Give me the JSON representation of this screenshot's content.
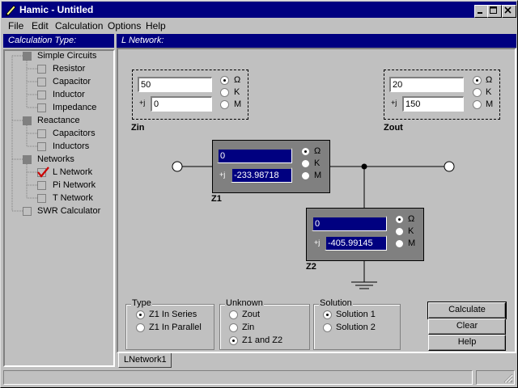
{
  "window": {
    "title": "Hamic - Untitled"
  },
  "menu": [
    "File",
    "Edit",
    "Calculation",
    "Options",
    "Help"
  ],
  "sidebar": {
    "header": "Calculation Type:",
    "items": [
      {
        "label": "Simple Circuits",
        "level": 0
      },
      {
        "label": "Resistor",
        "level": 1
      },
      {
        "label": "Capacitor",
        "level": 1
      },
      {
        "label": "Inductor",
        "level": 1
      },
      {
        "label": "Impedance",
        "level": 1
      },
      {
        "label": "Reactance",
        "level": 0
      },
      {
        "label": "Capacitors",
        "level": 1
      },
      {
        "label": "Inductors",
        "level": 1
      },
      {
        "label": "Networks",
        "level": 0
      },
      {
        "label": "L Network",
        "level": 1,
        "checked": true
      },
      {
        "label": "Pi Network",
        "level": 1
      },
      {
        "label": "T Network",
        "level": 1
      },
      {
        "label": "SWR Calculator",
        "level": 0
      }
    ]
  },
  "main": {
    "header": "L Network:",
    "units": [
      "Ω",
      "K",
      "M"
    ],
    "j_prefix": "+j",
    "zin": {
      "label": "Zin",
      "real": "50",
      "imag": "0",
      "unit": "Ω"
    },
    "zout": {
      "label": "Zout",
      "real": "20",
      "imag": "150",
      "unit": "Ω"
    },
    "z1": {
      "label": "Z1",
      "real": "0",
      "imag": "-233.98718",
      "unit": "Ω"
    },
    "z2": {
      "label": "Z2",
      "real": "0",
      "imag": "-405.99145",
      "unit": "Ω"
    },
    "type": {
      "title": "Type",
      "options": [
        "Z1 In Series",
        "Z1 In Parallel"
      ],
      "selected": "Z1 In Series"
    },
    "unknown": {
      "title": "Unknown",
      "options": [
        "Zout",
        "Zin",
        "Z1 and Z2"
      ],
      "selected": "Z1 and Z2"
    },
    "solution": {
      "title": "Solution",
      "options": [
        "Solution 1",
        "Solution 2"
      ],
      "selected": "Solution 1"
    },
    "buttons": {
      "calculate": "Calculate",
      "clear": "Clear",
      "help": "Help"
    },
    "tab": "LNetwork1"
  },
  "colors": {
    "titlebar": "#000080",
    "check": "#cc0000",
    "face": "#c0c0c0"
  }
}
